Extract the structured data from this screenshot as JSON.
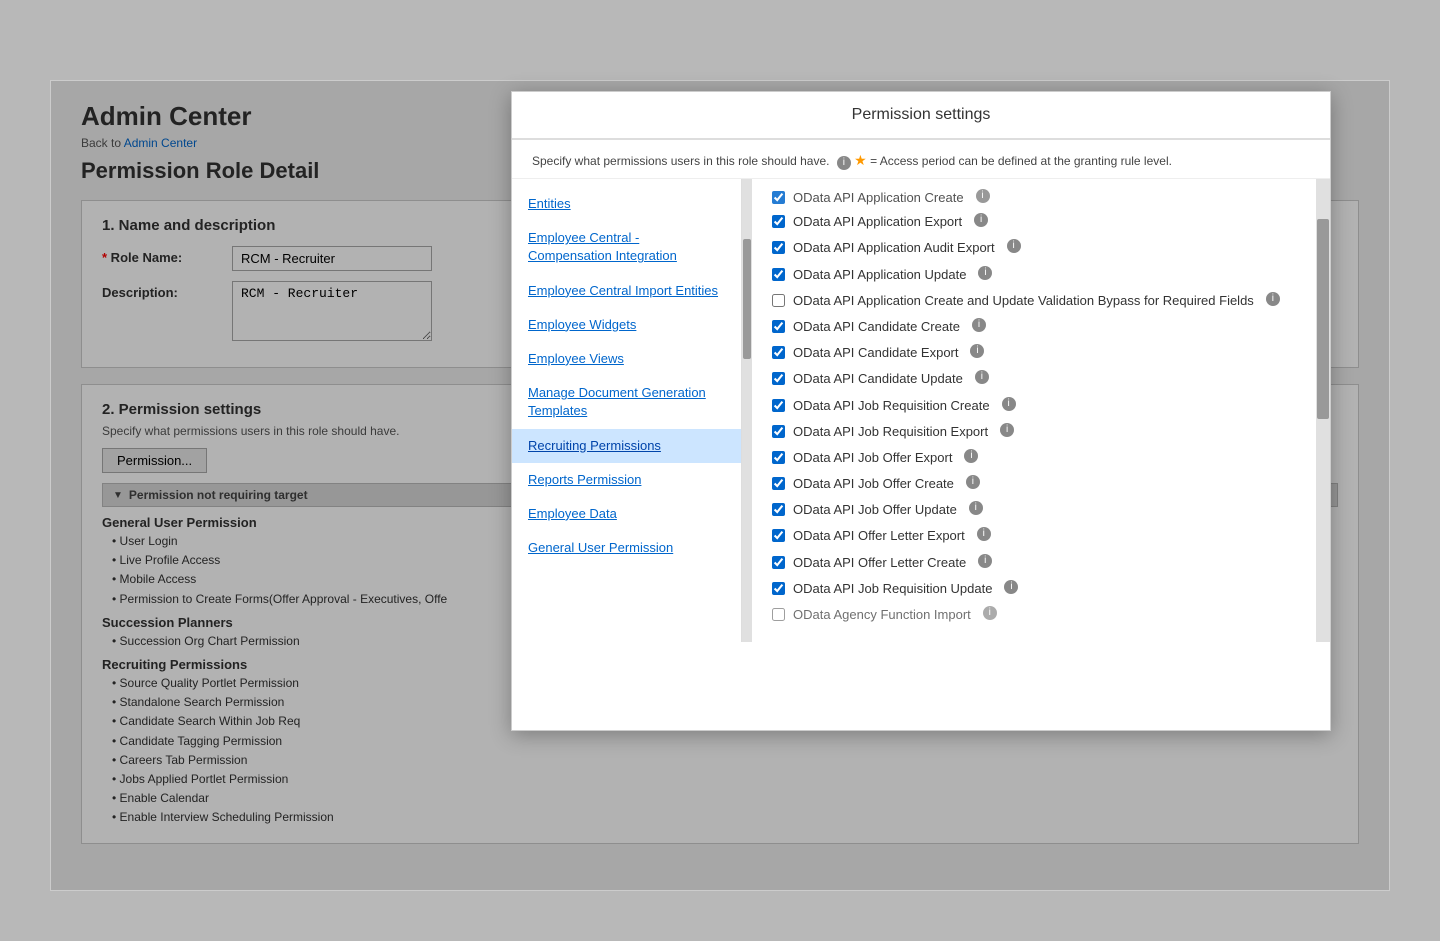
{
  "page": {
    "bg_title": "Admin Center",
    "breadcrumb_prefix": "Back to",
    "breadcrumb_link_text": "Admin Center",
    "breadcrumb_link_href": "#",
    "page_title": "Permission Role Detail"
  },
  "section1": {
    "heading": "1. Name and description",
    "role_name_label": "* Role Name:",
    "role_name_value": "RCM - Recruiter",
    "description_label": "Description:",
    "description_value": "RCM - Recruiter"
  },
  "section2": {
    "heading": "2. Permission settings",
    "desc": "Specify what permissions users in this role should have.",
    "permission_button": "Permission...",
    "not_requiring_target": "Permission not requiring target",
    "categories": [
      {
        "name": "General User Permission",
        "items": [
          "User Login",
          "Live Profile Access",
          "Mobile Access",
          "Permission to Create Forms(Offer Approval - Executives, Offe"
        ]
      },
      {
        "name": "Succession Planners",
        "items": [
          "Succession Org Chart Permission"
        ]
      },
      {
        "name": "Recruiting Permissions",
        "items": [
          "Source Quality Portlet Permission",
          "Standalone Search Permission",
          "Candidate Search Within Job Req",
          "Candidate Tagging Permission",
          "Careers Tab Permission",
          "Jobs Applied Portlet Permission",
          "Enable Calendar",
          "Enable Interview Scheduling Permission"
        ]
      }
    ]
  },
  "modal": {
    "title": "Permission settings",
    "intro": "Specify what permissions users in this role should have.",
    "info_icon": "i",
    "star_symbol": "★",
    "star_desc": "= Access period can be defined at the granting rule level.",
    "nav_items": [
      {
        "label": "Entities",
        "active": false
      },
      {
        "label": "Employee Central - Compensation Integration",
        "active": false
      },
      {
        "label": "Employee Central Import Entities",
        "active": false
      },
      {
        "label": "Employee Widgets",
        "active": false
      },
      {
        "label": "Employee Views",
        "active": false
      },
      {
        "label": "Manage Document Generation Templates",
        "active": false
      },
      {
        "label": "Recruiting Permissions",
        "active": true
      },
      {
        "label": "Reports Permission",
        "active": false
      },
      {
        "label": "Employee Data",
        "active": false
      },
      {
        "label": "General User Permission",
        "active": false
      }
    ],
    "permissions": [
      {
        "label": "OData API Application Create",
        "checked": true,
        "partial_top": true
      },
      {
        "label": "OData API Application Export",
        "checked": true
      },
      {
        "label": "OData API Application Audit Export",
        "checked": true
      },
      {
        "label": "OData API Application Update",
        "checked": true
      },
      {
        "label": "OData API Application Create and Update Validation Bypass for Required Fields",
        "checked": false,
        "multiline": true
      },
      {
        "label": "OData API Candidate Create",
        "checked": true
      },
      {
        "label": "OData API Candidate Export",
        "checked": true
      },
      {
        "label": "OData API Candidate Update",
        "checked": true
      },
      {
        "label": "OData API Job Requisition Create",
        "checked": true
      },
      {
        "label": "OData API Job Requisition Export",
        "checked": true
      },
      {
        "label": "OData API Job Offer Export",
        "checked": true
      },
      {
        "label": "OData API Job Offer Create",
        "checked": true
      },
      {
        "label": "OData API Job Offer Update",
        "checked": true
      },
      {
        "label": "OData API Offer Letter Export",
        "checked": true
      },
      {
        "label": "OData API Offer Letter Create",
        "checked": true
      },
      {
        "label": "OData API Job Requisition Update",
        "checked": true
      },
      {
        "label": "OData Agency Function Import",
        "checked": false,
        "partial_bottom": true
      }
    ]
  }
}
